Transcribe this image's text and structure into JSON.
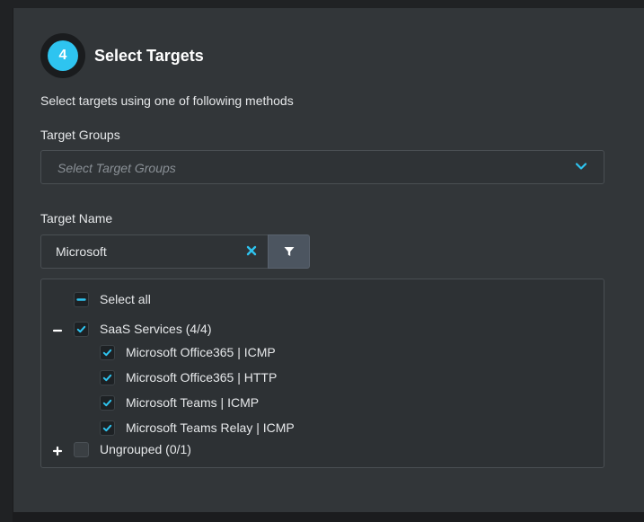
{
  "step": {
    "number": "4",
    "title": "Select Targets"
  },
  "subtitle": "Select targets using one of following methods",
  "target_groups": {
    "label": "Target Groups",
    "placeholder": "Select Target Groups"
  },
  "target_name": {
    "label": "Target Name",
    "value": "Microsoft"
  },
  "tree": {
    "select_all": "Select all",
    "groups": [
      {
        "label": "SaaS Services (4/4)",
        "expanded": true,
        "checked": true,
        "items": [
          {
            "label": "Microsoft Office365 | ICMP",
            "checked": true
          },
          {
            "label": "Microsoft Office365 | HTTP",
            "checked": true
          },
          {
            "label": "Microsoft Teams | ICMP",
            "checked": true
          },
          {
            "label": "Microsoft Teams Relay | ICMP",
            "checked": true
          }
        ]
      },
      {
        "label": "Ungrouped (0/1)",
        "expanded": false,
        "checked": false,
        "items": []
      }
    ]
  },
  "colors": {
    "accent": "#2ec4f0",
    "panel": "#323639",
    "input_bg": "#2f3336"
  }
}
